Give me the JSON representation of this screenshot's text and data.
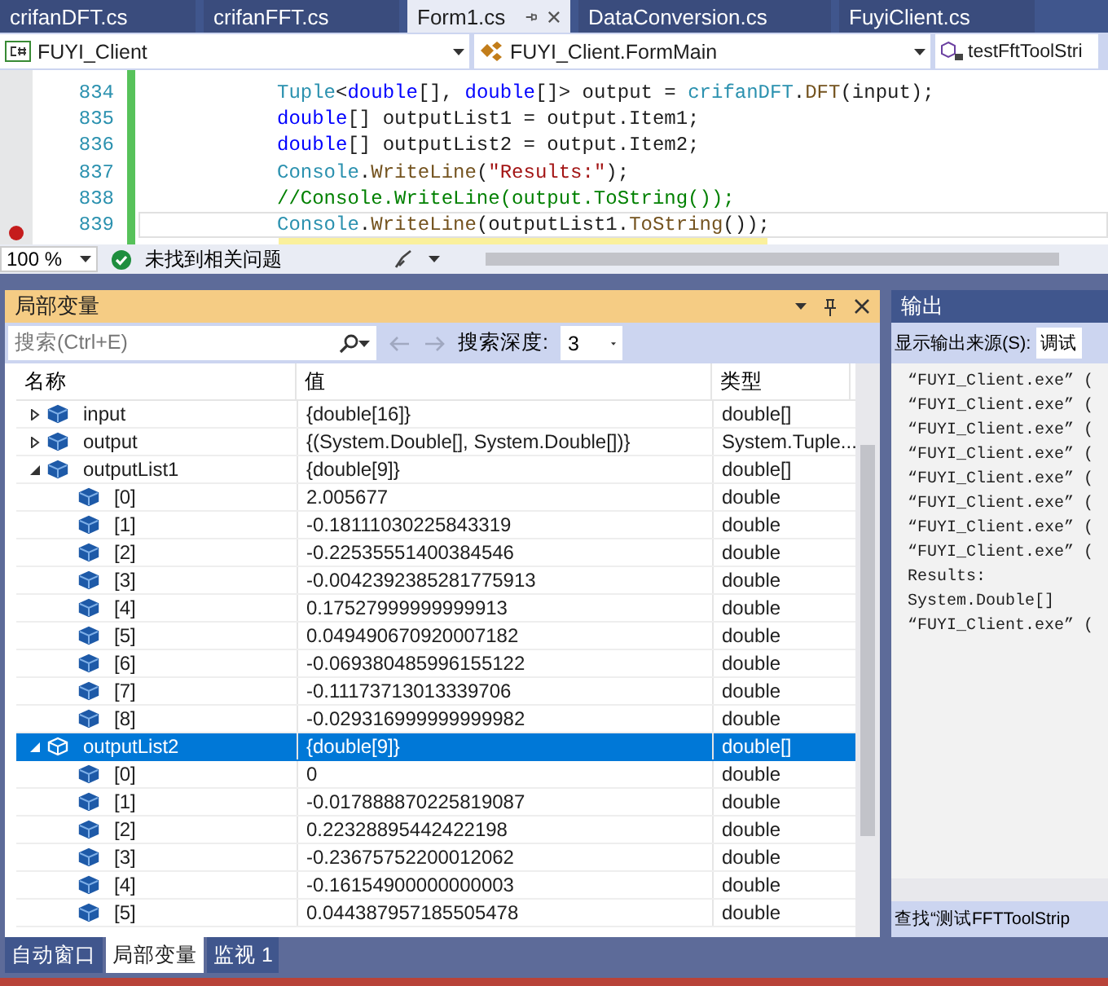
{
  "doc_tabs": [
    {
      "label": "crifanDFT.cs",
      "selected": false
    },
    {
      "label": "crifanFFT.cs",
      "selected": false
    },
    {
      "label": "Form1.cs",
      "selected": true
    },
    {
      "label": "DataConversion.cs",
      "selected": false
    },
    {
      "label": "FuyiClient.cs",
      "selected": false
    }
  ],
  "nav_bar": {
    "project": "FUYI_Client",
    "class": "FUYI_Client.FormMain",
    "member": "testFftToolStri"
  },
  "editor": {
    "lines": [
      {
        "number": "834",
        "current": false,
        "tokens": [
          {
            "text": "Tuple",
            "kind": "type"
          },
          {
            "text": "<",
            "kind": "plain"
          },
          {
            "text": "double",
            "kind": "keyword"
          },
          {
            "text": "[], ",
            "kind": "plain"
          },
          {
            "text": "double",
            "kind": "keyword"
          },
          {
            "text": "[]> output = ",
            "kind": "plain"
          },
          {
            "text": "crifanDFT",
            "kind": "type"
          },
          {
            "text": ".",
            "kind": "plain"
          },
          {
            "text": "DFT",
            "kind": "method"
          },
          {
            "text": "(input);",
            "kind": "plain"
          }
        ]
      },
      {
        "number": "835",
        "current": false,
        "tokens": [
          {
            "text": "double",
            "kind": "keyword"
          },
          {
            "text": "[] outputList1 = output.Item1;",
            "kind": "plain"
          }
        ]
      },
      {
        "number": "836",
        "current": false,
        "tokens": [
          {
            "text": "double",
            "kind": "keyword"
          },
          {
            "text": "[] outputList2 = output.Item2;",
            "kind": "plain"
          }
        ]
      },
      {
        "number": "837",
        "current": false,
        "tokens": [
          {
            "text": "Console",
            "kind": "type"
          },
          {
            "text": ".",
            "kind": "plain"
          },
          {
            "text": "WriteLine",
            "kind": "method"
          },
          {
            "text": "(",
            "kind": "plain"
          },
          {
            "text": "\"Results:\"",
            "kind": "string"
          },
          {
            "text": ");",
            "kind": "plain"
          }
        ]
      },
      {
        "number": "838",
        "current": false,
        "tokens": [
          {
            "text": "//Console.WriteLine(output.ToString());",
            "kind": "comment"
          }
        ]
      },
      {
        "number": "839",
        "current": true,
        "tokens": [
          {
            "text": "Console",
            "kind": "type"
          },
          {
            "text": ".",
            "kind": "plain"
          },
          {
            "text": "WriteLine",
            "kind": "method"
          },
          {
            "text": "(outputList1.",
            "kind": "plain"
          },
          {
            "text": "ToString",
            "kind": "method"
          },
          {
            "text": "());",
            "kind": "plain"
          }
        ]
      }
    ]
  },
  "editor_status": {
    "zoom": "100 %",
    "issues": "未找到相关问题"
  },
  "locals": {
    "title": "局部变量",
    "search_placeholder": "搜索(Ctrl+E)",
    "depth_label": "搜索深度:",
    "depth": "3",
    "columns": [
      "名称",
      "值",
      "类型"
    ],
    "rows": [
      {
        "name": "input",
        "value": "{double[16]}",
        "type": "double[]",
        "expanded": false,
        "selected": false
      },
      {
        "name": "output",
        "value": "{(System.Double[], System.Double[])}",
        "type": "System.Tuple...",
        "expanded": false,
        "selected": false
      },
      {
        "name": "outputList1",
        "value": "{double[9]}",
        "type": "double[]",
        "expanded": true,
        "selected": false,
        "children": [
          {
            "name": "[0]",
            "value": "2.005677",
            "type": "double",
            "selected": false
          },
          {
            "name": "[1]",
            "value": "-0.18111030225843319",
            "type": "double",
            "selected": false
          },
          {
            "name": "[2]",
            "value": "-0.22535551400384546",
            "type": "double",
            "selected": false
          },
          {
            "name": "[3]",
            "value": "-0.0042392385281775913",
            "type": "double",
            "selected": false
          },
          {
            "name": "[4]",
            "value": "0.17527999999999913",
            "type": "double",
            "selected": false
          },
          {
            "name": "[5]",
            "value": "0.049490670920007182",
            "type": "double",
            "selected": false
          },
          {
            "name": "[6]",
            "value": "-0.069380485996155122",
            "type": "double",
            "selected": false
          },
          {
            "name": "[7]",
            "value": "-0.11173713013339706",
            "type": "double",
            "selected": false
          },
          {
            "name": "[8]",
            "value": "-0.029316999999999982",
            "type": "double",
            "selected": false
          }
        ]
      },
      {
        "name": "outputList2",
        "value": "{double[9]}",
        "type": "double[]",
        "expanded": true,
        "selected": true,
        "children": [
          {
            "name": "[0]",
            "value": "0",
            "type": "double",
            "selected": false
          },
          {
            "name": "[1]",
            "value": "-0.017888870225819087",
            "type": "double",
            "selected": false
          },
          {
            "name": "[2]",
            "value": "0.22328895442422198",
            "type": "double",
            "selected": false
          },
          {
            "name": "[3]",
            "value": "-0.23675752200012062",
            "type": "double",
            "selected": false
          },
          {
            "name": "[4]",
            "value": "-0.16154900000000003",
            "type": "double",
            "selected": false
          },
          {
            "name": "[5]",
            "value": "0.044387957185505478",
            "type": "double",
            "selected": false
          }
        ]
      }
    ]
  },
  "bottom_tabs": [
    {
      "label": "自动窗口",
      "selected": false
    },
    {
      "label": "局部变量",
      "selected": true
    },
    {
      "label": "监视 1",
      "selected": false
    }
  ],
  "output": {
    "title": "输出",
    "source_label": "显示输出来源(S):",
    "source": "调试",
    "lines": [
      "“FUYI_Client.exe” (",
      "“FUYI_Client.exe” (",
      "“FUYI_Client.exe” (",
      "“FUYI_Client.exe” (",
      "“FUYI_Client.exe” (",
      "“FUYI_Client.exe” (",
      "“FUYI_Client.exe” (",
      "“FUYI_Client.exe” (",
      "Results:",
      "System.Double[]",
      "“FUYI_Client.exe” ("
    ],
    "find_status": "查找“测试FFTToolStrip"
  }
}
